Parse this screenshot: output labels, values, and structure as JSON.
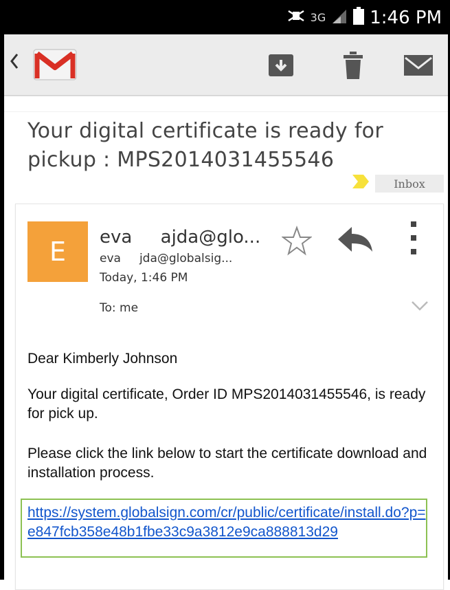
{
  "status_bar": {
    "network": "3G",
    "time": "1:46 PM"
  },
  "action_bar": {
    "back_icon": "chevron-left-icon",
    "app_icon": "gmail-logo",
    "actions": [
      "archive-icon",
      "delete-icon",
      "mark-unread-icon"
    ]
  },
  "email": {
    "subject": "Your digital certificate is ready for pickup : MPS2014031455546",
    "label": "Inbox",
    "sender": {
      "initial": "E",
      "name": "eva     ajda@glo...",
      "email": "eva     jda@globalsig...",
      "date": "Today, 1:46 PM",
      "to": "To: me"
    },
    "body": {
      "greeting": "Dear Kimberly Johnson",
      "paragraph1": "Your digital certificate, Order ID MPS2014031455546, is ready for pick up.",
      "paragraph2": "Please click the link below to start the certificate download and installation process.",
      "link": "https://system.globalsign.com/cr/public/certificate/install.do?p=e847fcb358e48b1fbe33c9a3812e9ca888813d29"
    }
  },
  "colors": {
    "avatar": "#f4a13a",
    "link": "#1155cc",
    "highlight_box": "#8cc152",
    "label_marker": "#f7e13b"
  }
}
